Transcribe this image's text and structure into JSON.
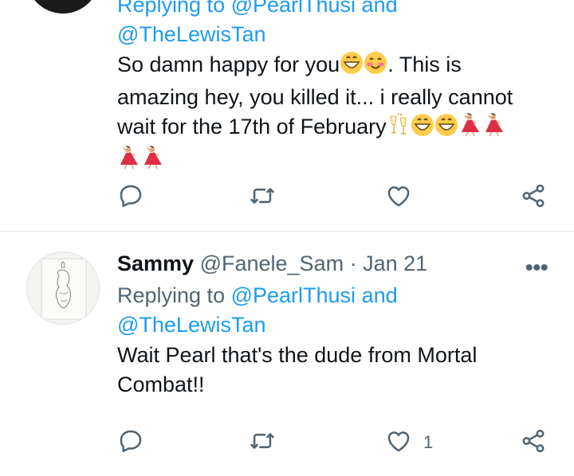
{
  "tweet1": {
    "reply_prefix_partial": "Replying to @PearlThusi and",
    "reply_handle2": "@TheLewisTan",
    "body_line1": "So damn happy for you",
    "body_line1_tail": ". This is",
    "body_line2": "amazing hey, you killed it... i really cannot",
    "body_line3": "wait for the 17th of February"
  },
  "tweet2": {
    "name": "Sammy",
    "handle": "@Fanele_Sam",
    "separator": " · ",
    "date": "Jan 21",
    "more": "•••",
    "reply_prefix": "Replying to ",
    "reply_handle1": "@PearlThusi",
    "reply_and": " and",
    "reply_handle2": "@TheLewisTan",
    "body_line1": "Wait Pearl that's the dude from Mortal",
    "body_line2": "Combat!!",
    "like_count": "1"
  },
  "icons": {
    "reply": "comment-icon",
    "retweet": "retweet-icon",
    "like": "heart-icon",
    "share": "share-icon"
  },
  "colors": {
    "link": "#1d9bf0",
    "secondary_text": "#536471",
    "divider": "#e6ecf0"
  }
}
